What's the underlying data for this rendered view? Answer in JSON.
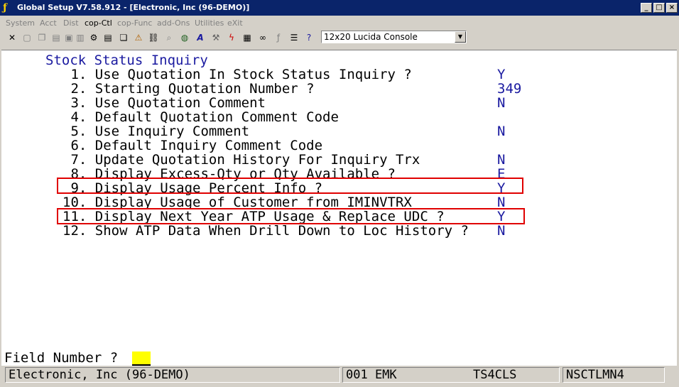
{
  "window": {
    "title": "Global Setup V7.58.912 - [Electronic, Inc (96-DEMO)]"
  },
  "menu": [
    "System",
    "Acct",
    "Dist",
    "cop-Ctl",
    "cop-Func",
    "add-Ons",
    "Utilities",
    "eXit"
  ],
  "toolbar": {
    "font": "12x20 Lucida Console"
  },
  "screen": {
    "heading": "Stock Status Inquiry",
    "items": [
      {
        "label": " 1. Use Quotation In Stock Status Inquiry ?",
        "value": "Y"
      },
      {
        "label": " 2. Starting Quotation Number ?",
        "value": "349"
      },
      {
        "label": " 3. Use Quotation Comment",
        "value": "N"
      },
      {
        "label": " 4. Default Quotation Comment Code",
        "value": ""
      },
      {
        "label": " 5. Use Inquiry Comment",
        "value": "N"
      },
      {
        "label": " 6. Default Inquiry Comment Code",
        "value": ""
      },
      {
        "label": " 7. Update Quotation History For Inquiry Trx",
        "value": "N"
      },
      {
        "label": " 8. Display Excess-Qty or Qty Available ?",
        "value": "E"
      },
      {
        "label": " 9. Display Usage Percent Info ?",
        "value": "Y"
      },
      {
        "label": "10. Display Usage of Customer from IMINVTRX",
        "value": "N"
      },
      {
        "label": "11. Display Next Year ATP Usage & Replace UDC ?",
        "value": "Y"
      },
      {
        "label": "12. Show ATP Data When Drill Down to Loc History ?",
        "value": "N"
      }
    ]
  },
  "prompt": {
    "label": "Field Number ?",
    "value": ""
  },
  "status": {
    "company": "Electronic, Inc (96-DEMO)",
    "user": "001 EMK",
    "terminal": "TS4CLS",
    "program": "NSCTLMN4"
  },
  "colors": {
    "titlebar": "#0a246a",
    "value_text": "#1a1aa0",
    "highlight": "#e00000",
    "cursor": "#ffff00"
  }
}
